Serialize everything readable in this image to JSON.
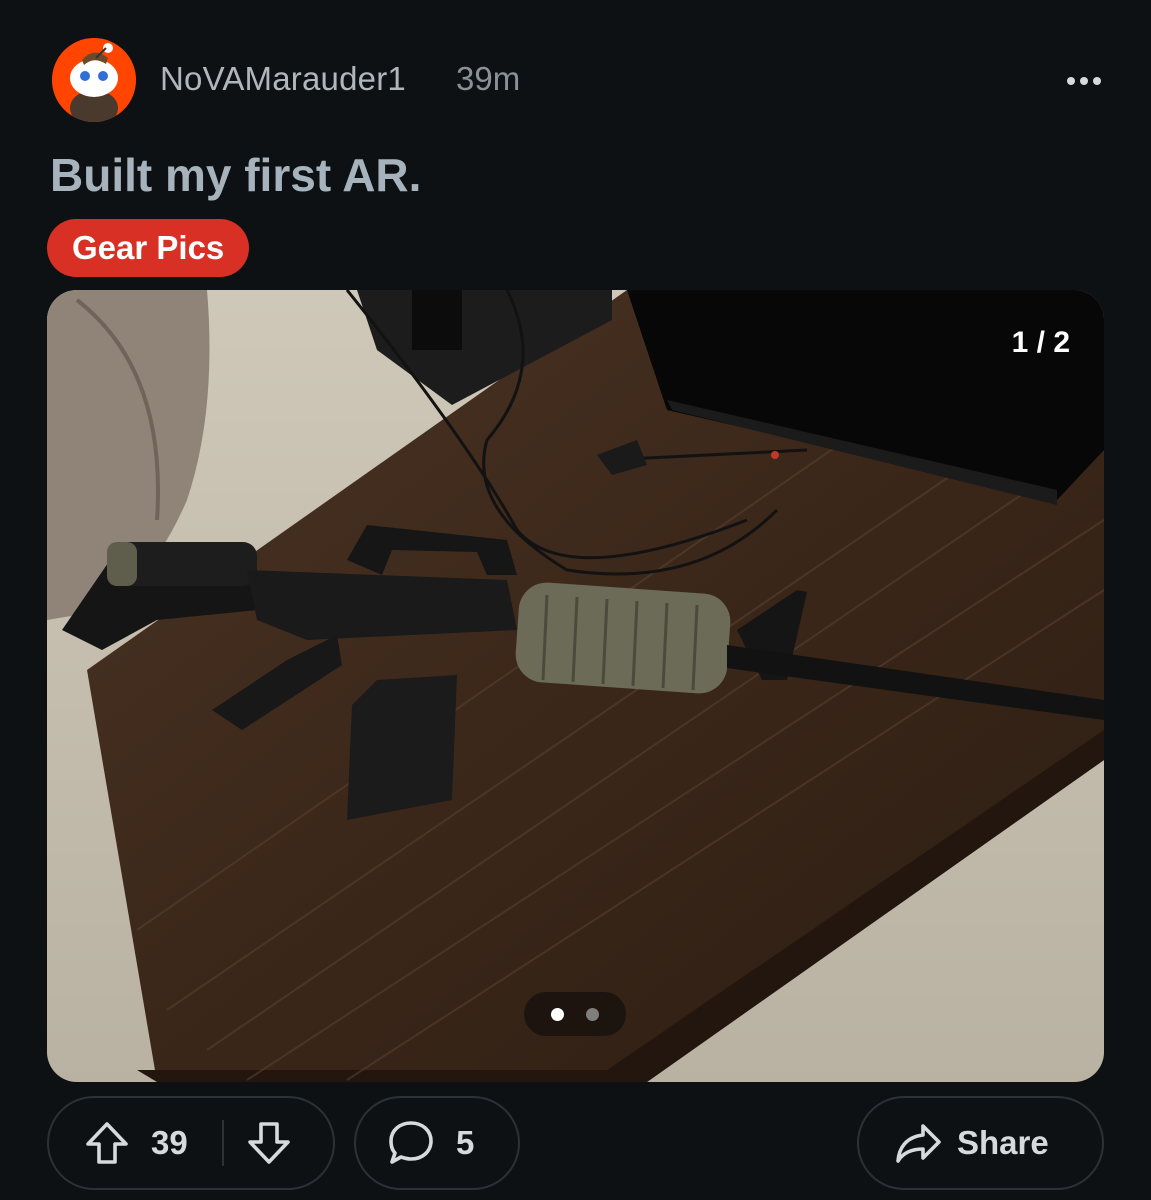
{
  "post": {
    "author": "NoVAMarauder1",
    "age": "39m",
    "title": "Built my first AR.",
    "flair": "Gear Pics"
  },
  "media": {
    "counter": "1 / 2",
    "image_index": 1,
    "image_count": 2
  },
  "actions": {
    "upvotes": "39",
    "comments": "5",
    "share_label": "Share"
  },
  "colors": {
    "background": "#0e1113",
    "flair": "#d93025",
    "avatar": "#ff4500",
    "pill_border": "#2b3236"
  },
  "icons": [
    "snoo-avatar",
    "more-icon",
    "upvote-icon",
    "downvote-icon",
    "comment-icon",
    "share-icon"
  ]
}
